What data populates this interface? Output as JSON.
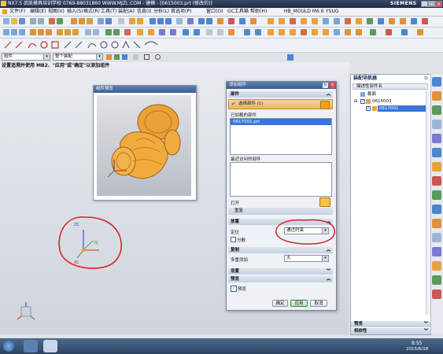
{
  "window": {
    "title": "NX7.5  武凯模具培训学校  0769-88031860  WWW.MJZL.COM - 建模 - [0615003.prt (修改的)]",
    "brand": "SIEMENS",
    "controls": [
      "_",
      "□",
      "×"
    ]
  },
  "menubar": {
    "items": [
      "文件(F)",
      "编辑(E)",
      "视图(V)",
      "插入(S)",
      "格式(R)",
      "工具(T)",
      "装配(A)",
      "信息(I)",
      "分析(L)",
      "首选项(P)",
      "窗口(O)",
      "GC工具箱",
      "帮助(H)",
      "HB_MOULD M6.6",
      "YSUG"
    ]
  },
  "filter": {
    "type": "组件",
    "scope": "整个装配"
  },
  "cue_line": "设置追溯并使用 MB2、\"应用\"或\"确定\"以添加组件",
  "preview": {
    "title": "组件预览"
  },
  "triad_labels": {
    "x": "XC",
    "y": "YC",
    "z": "ZC"
  },
  "add_component": {
    "title": "添加组件",
    "section_part": "部件",
    "select_part_label": "选择部件 (1)",
    "loaded_parts_label": "已加载的部件",
    "loaded_parts": [
      "0617001.prt"
    ],
    "recent_parts_label": "最近访问的部件",
    "open_label": "打开",
    "repeat_label": "重复",
    "section_placement": "放置",
    "positioning_label": "定位",
    "positioning_value": "通过约束",
    "scatter_label": "分散",
    "section_copy": "复制",
    "multi_add_label": "多重添加",
    "multi_add_value": "无",
    "section_settings": "设置",
    "section_preview": "预览",
    "preview_label": "预览",
    "preview_checked": true,
    "buttons": {
      "ok": "确定",
      "apply": "应用",
      "cancel": "取消"
    }
  },
  "assembly_navigator": {
    "title": "装配导航器",
    "column_header": "描述性部件名",
    "items": [
      {
        "label": "截面",
        "depth": 1
      },
      {
        "label": "0615003",
        "depth": 1
      },
      {
        "label": "0617001",
        "depth": 2,
        "selected": true
      }
    ],
    "footer_sections": [
      "预览",
      "相依性"
    ]
  },
  "taskbar": {
    "time": "8:55",
    "date": "2015/6/18"
  },
  "colors": {
    "accent": "#f0a020",
    "selection": "#3875d7",
    "annotation": "#d4242a"
  }
}
